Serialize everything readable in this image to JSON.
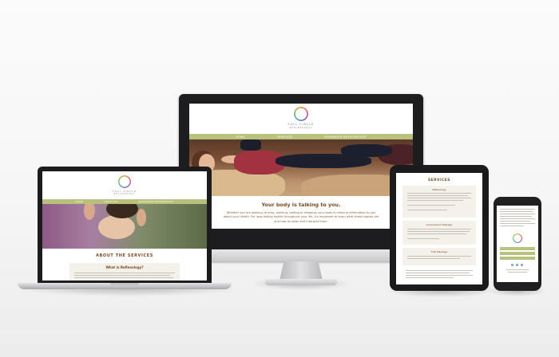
{
  "brand": {
    "name": "FULL CIRCLE",
    "tagline": "REFLEXOLOGY"
  },
  "nav": {
    "items": [
      "HOME",
      "SERVICES",
      "ADVANCED REFLEXOLOGY"
    ]
  },
  "desktop": {
    "hero_heading": "Your body is talking to you.",
    "hero_body": "Whether you are walking, driving, working, resting or sleeping; your body is relaying information to you about your health. For long lasting health throughout your life, it's important to learn what these signals are and how to listen and interpret them."
  },
  "laptop": {
    "section_title": "ABOUT THE SERVICES",
    "subsection_title": "What is Reflexology?"
  },
  "tablet": {
    "heading": "SERVICES",
    "items": [
      "Reflexology",
      "Acupressure Massage",
      "Thai Massage"
    ]
  },
  "colors": {
    "nav_green": "#b8c27c",
    "heading_brown": "#7b4a21",
    "body_brown": "#8a5a30"
  }
}
